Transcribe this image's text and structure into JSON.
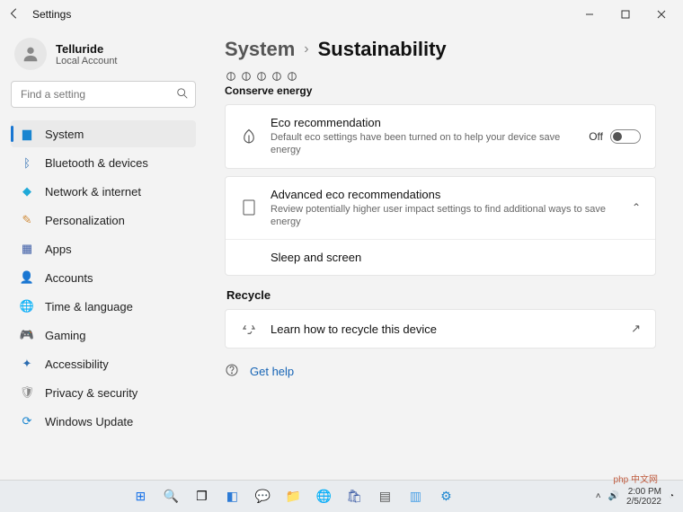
{
  "titlebar": {
    "title": "Settings"
  },
  "account": {
    "name": "Telluride",
    "type": "Local Account"
  },
  "search": {
    "placeholder": "Find a setting"
  },
  "nav": [
    {
      "label": "System",
      "active": true
    },
    {
      "label": "Bluetooth & devices"
    },
    {
      "label": "Network & internet"
    },
    {
      "label": "Personalization"
    },
    {
      "label": "Apps"
    },
    {
      "label": "Accounts"
    },
    {
      "label": "Time & language"
    },
    {
      "label": "Gaming"
    },
    {
      "label": "Accessibility"
    },
    {
      "label": "Privacy & security"
    },
    {
      "label": "Windows Update"
    }
  ],
  "breadcrumb": {
    "a": "System",
    "b": "Sustainability"
  },
  "conserve_header": "Conserve energy",
  "eco": {
    "title": "Eco recommendation",
    "sub": "Default eco settings have been turned on to help your device save energy",
    "state": "Off"
  },
  "advanced": {
    "title": "Advanced eco recommendations",
    "sub": "Review potentially higher user impact settings to find additional ways to save energy",
    "child": "Sleep and screen"
  },
  "recycle": {
    "header": "Recycle",
    "row": "Learn how to recycle this device"
  },
  "help": "Get help",
  "tray": {
    "time": "2:00 PM",
    "date": "2/5/2022"
  }
}
